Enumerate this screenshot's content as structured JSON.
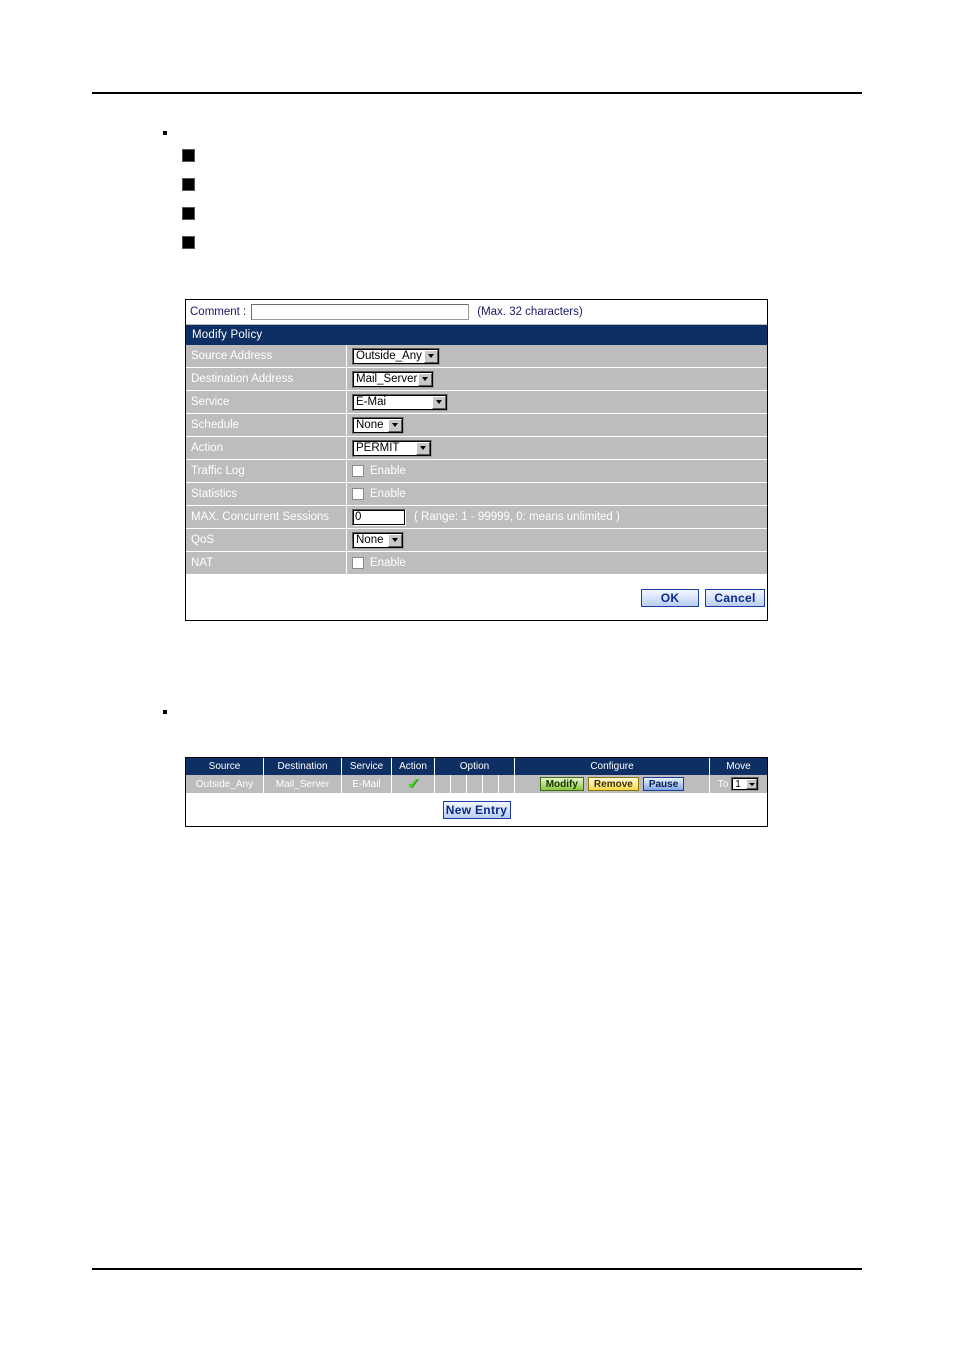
{
  "page": {
    "bullets": {
      "dot_top": "",
      "square_items": [
        "",
        "",
        "",
        ""
      ],
      "dot_bottom": ""
    }
  },
  "policy_form": {
    "comment": {
      "label": "Comment :",
      "value": "",
      "placeholder": "",
      "hint": "(Max. 32 characters)"
    },
    "title": "Modify Policy",
    "rows": [
      {
        "label": "Source Address",
        "control": "select",
        "value": "Outside_Any"
      },
      {
        "label": "Destination Address",
        "control": "select",
        "value": "Mail_Server"
      },
      {
        "label": "Service",
        "control": "select",
        "value": "E-Mai"
      },
      {
        "label": "Schedule",
        "control": "select",
        "value": "None"
      },
      {
        "label": "Action",
        "control": "select",
        "value": "PERMIT"
      },
      {
        "label": "Traffic Log",
        "control": "checkbox",
        "value": "Enable",
        "checked": false
      },
      {
        "label": "Statistics",
        "control": "checkbox",
        "value": "Enable",
        "checked": false
      },
      {
        "label": "MAX. Concurrent Sessions",
        "control": "text",
        "value": "0",
        "hint": "( Range: 1 - 99999, 0: means unlimited )"
      },
      {
        "label": "QoS",
        "control": "select",
        "value": "None"
      },
      {
        "label": "NAT",
        "control": "checkbox",
        "value": "Enable",
        "checked": false
      }
    ],
    "buttons": {
      "ok": "OK",
      "cancel": "Cancel"
    }
  },
  "policy_table": {
    "headers": [
      "Source",
      "Destination",
      "Service",
      "Action",
      "Option",
      "Configure",
      "Move"
    ],
    "option_cell_count": 5,
    "rows": [
      {
        "source": "Outside_Any",
        "destination": "Mail_Server",
        "service": "E-Mail",
        "action_icon": "check-mark-icon",
        "options": [
          "",
          "",
          "",
          "",
          ""
        ],
        "configure": [
          "Modify",
          "Remove",
          "Pause"
        ],
        "move_label": "To",
        "move_value": "1"
      }
    ],
    "new_entry": "New Entry"
  },
  "colors": {
    "title_bar": "#0d2f63",
    "row_bg": "#bdbdbd",
    "label_text": "#ffffff",
    "comment_text": "#1a1a66",
    "check": "#44dd22",
    "modify": "#8cc63f",
    "remove": "#f5d94a",
    "pause": "#7fa6e4"
  }
}
